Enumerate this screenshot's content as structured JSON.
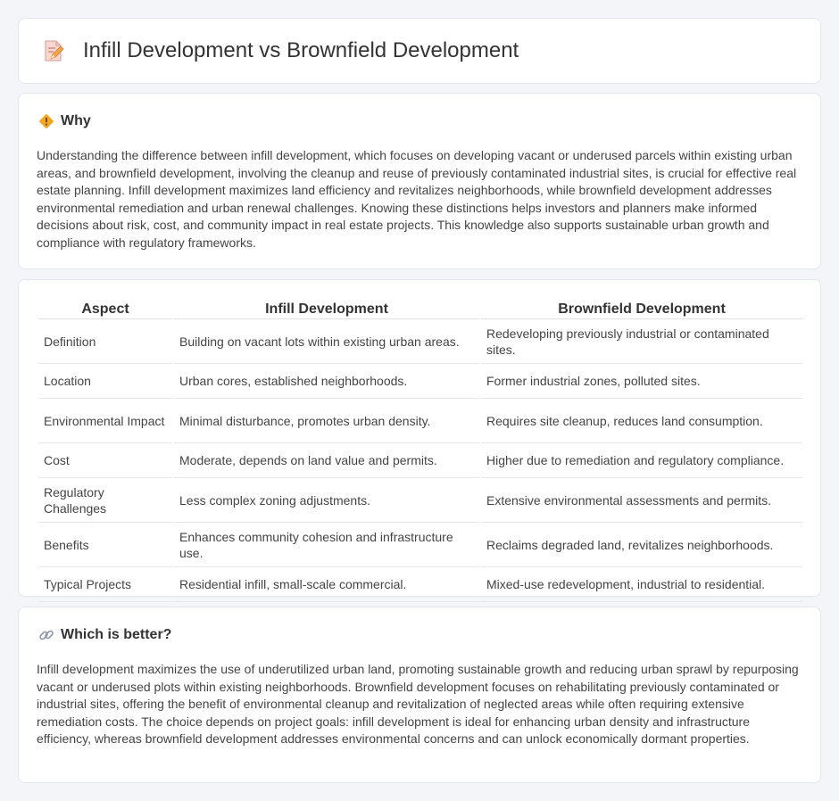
{
  "header": {
    "title": "Infill Development vs Brownfield Development",
    "icon": "document-pen-icon"
  },
  "why": {
    "title": "Why",
    "icon": "diamond-warning-icon",
    "body": "Understanding the difference between infill development, which focuses on developing vacant or underused parcels within existing urban areas, and brownfield development, involving the cleanup and reuse of previously contaminated industrial sites, is crucial for effective real estate planning. Infill development maximizes land efficiency and revitalizes neighborhoods, while brownfield development addresses environmental remediation and urban renewal challenges. Knowing these distinctions helps investors and planners make informed decisions about risk, cost, and community impact in real estate projects. This knowledge also supports sustainable urban growth and compliance with regulatory frameworks."
  },
  "table": {
    "headers": [
      "Aspect",
      "Infill Development",
      "Brownfield Development"
    ],
    "rows": [
      [
        "Definition",
        "Building on vacant lots within existing urban areas.",
        "Redeveloping previously industrial or contaminated sites."
      ],
      [
        "Location",
        "Urban cores, established neighborhoods.",
        "Former industrial zones, polluted sites."
      ],
      [
        "Environmental Impact",
        "Minimal disturbance, promotes urban density.",
        "Requires site cleanup, reduces land consumption."
      ],
      [
        "Cost",
        "Moderate, depends on land value and permits.",
        "Higher due to remediation and regulatory compliance."
      ],
      [
        "Regulatory Challenges",
        "Less complex zoning adjustments.",
        "Extensive environmental assessments and permits."
      ],
      [
        "Benefits",
        "Enhances community cohesion and infrastructure use.",
        "Reclaims degraded land, revitalizes neighborhoods."
      ],
      [
        "Typical Projects",
        "Residential infill, small-scale commercial.",
        "Mixed-use redevelopment, industrial to residential."
      ]
    ]
  },
  "better": {
    "title": "Which is better?",
    "icon": "link-icon",
    "body": "Infill development maximizes the use of underutilized urban land, promoting sustainable growth and reducing urban sprawl by repurposing vacant or underused plots within existing neighborhoods. Brownfield development focuses on rehabilitating previously contaminated or industrial sites, offering the benefit of environmental cleanup and revitalization of neglected areas while often requiring extensive remediation costs. The choice depends on project goals: infill development is ideal for enhancing urban density and infrastructure efficiency, whereas brownfield development addresses environmental concerns and can unlock economically dormant properties."
  }
}
